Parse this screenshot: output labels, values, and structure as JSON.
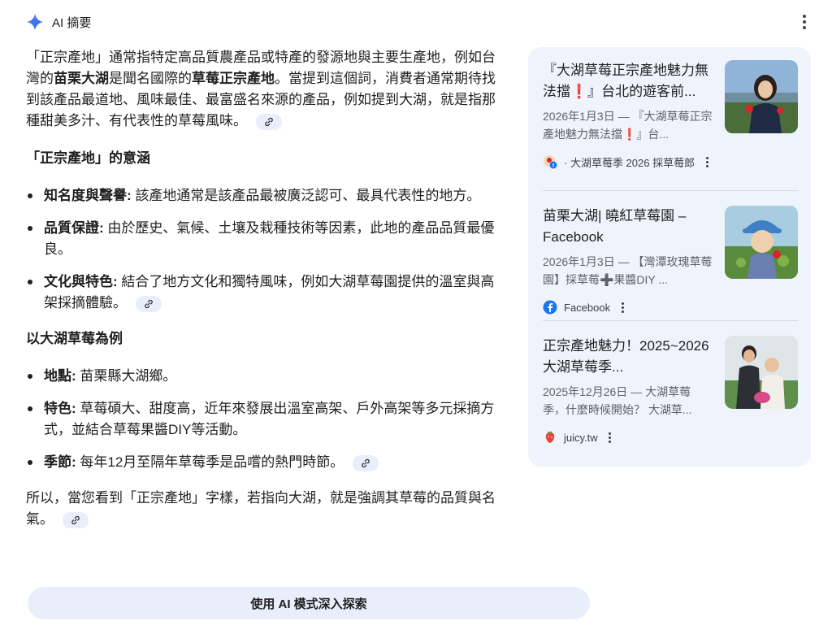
{
  "header": {
    "title": "AI 摘要",
    "icon": "sparkle-icon",
    "more_icon": "more-vert-icon"
  },
  "intro": {
    "t1": "「正宗產地」通常指特定高品質農產品或特產的發源地與主要生產地，例如台灣的",
    "b1": "苗栗大湖",
    "t2": "是聞名國際的",
    "b2": "草莓正宗產地",
    "t3": "。當提到這個詞，消費者通常期待找到該產品最道地、風味最佳、最富盛名來源的產品，例如提到大湖，就是指那種甜美多汁、有代表性的草莓風味。"
  },
  "section1": {
    "heading": "「正宗產地」的意涵",
    "items": [
      {
        "term": "知名度與聲譽:",
        "text": " 該產地通常是該產品最被廣泛認可、最具代表性的地方。"
      },
      {
        "term": "品質保證:",
        "text": " 由於歷史、氣候、土壤及栽種技術等因素，此地的產品品質最優良。"
      },
      {
        "term": "文化與特色:",
        "text": " 結合了地方文化和獨特風味，例如大湖草莓園提供的溫室與高架採摘體驗。"
      }
    ]
  },
  "section2": {
    "heading": "以大湖草莓為例",
    "items": [
      {
        "term": "地點:",
        "text": " 苗栗縣大湖鄉。"
      },
      {
        "term": "特色:",
        "text": " 草莓碩大、甜度高，近年來發展出溫室高架、戶外高架等多元採摘方式，並結合草莓果醬DIY等活動。"
      },
      {
        "term": "季節:",
        "text": " 每年12月至隔年草莓季是品嚐的熱門時節。"
      }
    ]
  },
  "conclusion": "所以，當您看到「正宗產地」字樣，若指向大湖，就是強調其草莓的品質與名氣。",
  "ai_mode_button": "使用 AI 模式深入探索",
  "sources": [
    {
      "title": "『大湖草莓正宗產地魅力無法擋❗』台北的遊客前...",
      "snippet": "2026年1月3日 — 『大湖草莓正宗產地魅力無法擋❗』台...",
      "source": "· 大湖草莓季 2026 採草莓郎",
      "icon": "facebook-profile-icon"
    },
    {
      "title": "苗栗大湖| 曉紅草莓園 – Facebook",
      "snippet": "2026年1月3日 — 【灣潭玫瑰草莓園】採草莓➕果醬DIY ...",
      "source": "Facebook",
      "icon": "facebook-icon"
    },
    {
      "title": "正宗產地魅力！2025~2026大湖草莓季...",
      "snippet": "2025年12月26日 — 大湖草莓季，什麼時候開始？ 大湖草...",
      "source": "juicy.tw",
      "icon": "juicy-logo-icon"
    }
  ],
  "colors": {
    "accent": "#4285f4",
    "panel_bg": "#eef3fc",
    "chip_bg": "#e8eefa"
  }
}
